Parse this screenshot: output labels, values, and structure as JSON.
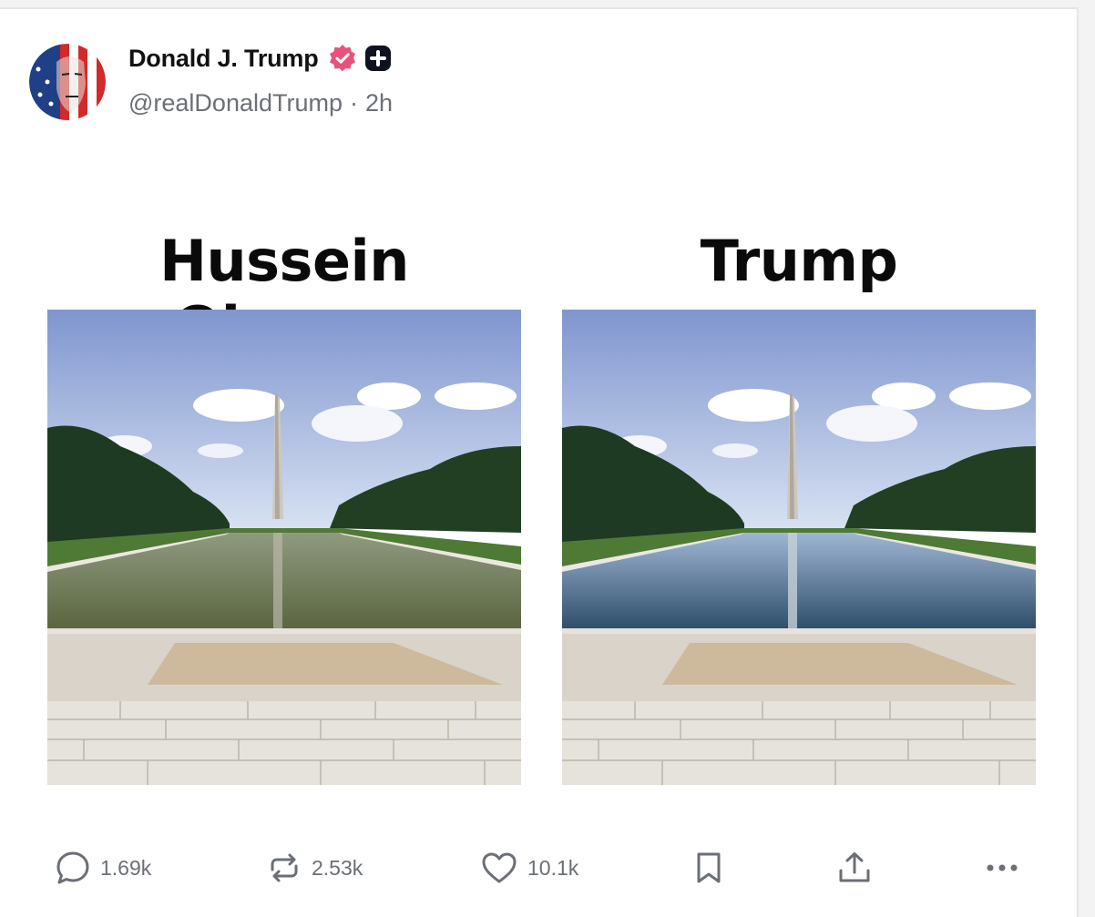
{
  "post": {
    "author_name": "Donald J. Trump",
    "handle": "@realDonaldTrump",
    "separator": "·",
    "time": "2h",
    "badges": [
      "verified-badge-icon",
      "plus-badge-icon"
    ],
    "avatar": "flag-portrait-avatar",
    "meme": {
      "left_caption": "Hussein Obama",
      "right_caption": "Trump",
      "left_photo": "washington-monument-reflecting-pool-murky-green-water",
      "right_photo": "washington-monument-reflecting-pool-clear-blue-water"
    }
  },
  "actions": {
    "reply_count": "1.69k",
    "repost_count": "2.53k",
    "like_count": "10.1k"
  },
  "colors": {
    "accent_badge": "#e8527a",
    "muted_text": "#6b6f76",
    "icon_gray": "#6b6f76"
  }
}
